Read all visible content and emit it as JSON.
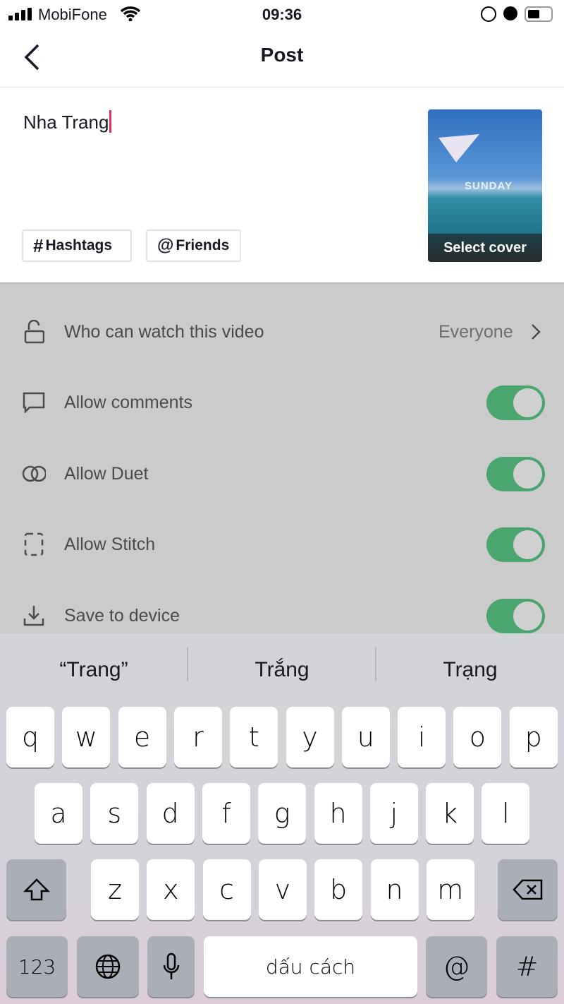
{
  "status": {
    "carrier": "MobiFone",
    "time": "09:36"
  },
  "nav": {
    "title": "Post"
  },
  "compose": {
    "caption": "Nha Trang",
    "hashtags": "Hashtags",
    "friends": "Friends",
    "hash_symbol": "#",
    "at_symbol": "@",
    "select_cover": "Select cover",
    "cover_overlay_text": "SUNDAY"
  },
  "settings": {
    "who": {
      "label": "Who can watch this video",
      "value": "Everyone"
    },
    "items": [
      {
        "label": "Allow comments",
        "on": true,
        "icon": "comment-icon"
      },
      {
        "label": "Allow Duet",
        "on": true,
        "icon": "duet-icon"
      },
      {
        "label": "Allow Stitch",
        "on": true,
        "icon": "stitch-icon"
      },
      {
        "label": "Save to device",
        "on": true,
        "icon": "download-icon"
      }
    ],
    "toggle_color": "#4aa56f"
  },
  "keyboard": {
    "suggestions": [
      "“Trang”",
      "Trắng",
      "Trạng"
    ],
    "row1": [
      "q",
      "w",
      "e",
      "r",
      "t",
      "y",
      "u",
      "i",
      "o",
      "p"
    ],
    "row2": [
      "a",
      "s",
      "d",
      "f",
      "g",
      "h",
      "j",
      "k",
      "l"
    ],
    "row3": [
      "z",
      "x",
      "c",
      "v",
      "b",
      "n",
      "m"
    ],
    "numbers": "123",
    "space": "dấu cách",
    "at": "@",
    "hash": "#"
  }
}
